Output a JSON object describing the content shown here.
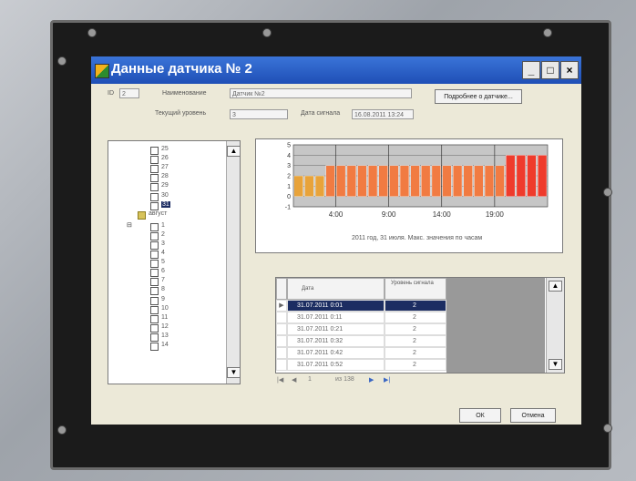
{
  "window": {
    "title": "Данные датчика № 2",
    "controls": {
      "minimize": "_",
      "maximize": "□",
      "close": "×"
    }
  },
  "header": {
    "id_label": "ID",
    "id_value": "2",
    "name_label": "Наименование",
    "name_value": "Датчик №2",
    "current_level_label": "Текущий уровень",
    "current_level_value": "3",
    "signal_date_label": "Дата сигнала",
    "signal_date_value": "16.08.2011 13:24",
    "details_button": "Подробнее о датчике..."
  },
  "tree": {
    "days_top": [
      "25",
      "26",
      "27",
      "28",
      "29",
      "30",
      "31"
    ],
    "selected_day": "31",
    "month_label": "август",
    "days_bottom": [
      "1",
      "2",
      "3",
      "4",
      "5",
      "6",
      "7",
      "8",
      "9",
      "10",
      "11",
      "12",
      "13",
      "14"
    ]
  },
  "chart": {
    "caption": "2011 год, 31 июля.  Макс. значения по часам"
  },
  "chart_data": {
    "type": "bar",
    "ylim": [
      -1,
      5
    ],
    "yticks": [
      "5",
      "4",
      "3",
      "2",
      "1",
      "0",
      "-1"
    ],
    "xticks": [
      "4:00",
      "9:00",
      "14:00",
      "19:00"
    ],
    "values": [
      2,
      2,
      2,
      3,
      3,
      3,
      3,
      3,
      3,
      3,
      3,
      3,
      3,
      3,
      3,
      3,
      3,
      3,
      3,
      3,
      4,
      4,
      4,
      4
    ],
    "colors": {
      "low": "#e8a33a",
      "mid": "#f17b42",
      "high": "#ef3b2c"
    }
  },
  "grid": {
    "headers": [
      "Дата",
      "Уровень сигнала"
    ],
    "rows": [
      {
        "date": "31.07.2011 0:01",
        "level": "2"
      },
      {
        "date": "31.07.2011 0:11",
        "level": "2"
      },
      {
        "date": "31.07.2011 0:21",
        "level": "2"
      },
      {
        "date": "31.07.2011 0:32",
        "level": "2"
      },
      {
        "date": "31.07.2011 0:42",
        "level": "2"
      },
      {
        "date": "31.07.2011 0:52",
        "level": "2"
      }
    ],
    "nav_page": "1",
    "nav_of": "из 138"
  },
  "buttons": {
    "ok": "ОК",
    "cancel": "Отмена"
  }
}
